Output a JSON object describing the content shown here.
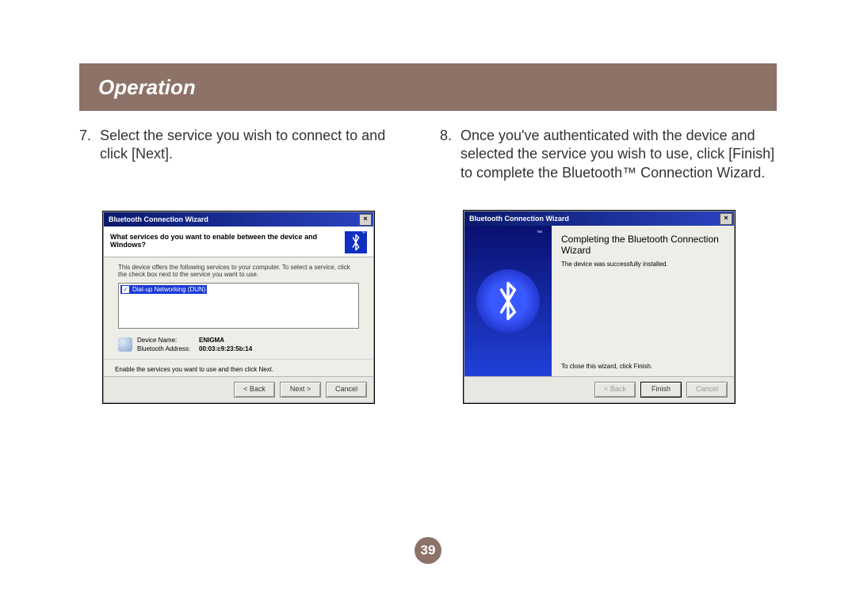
{
  "header": "Operation",
  "page_number": "39",
  "steps": [
    {
      "num": "7.",
      "text": "Select the service you wish to connect to and click [Next]."
    },
    {
      "num": "8.",
      "text": "Once you've authenticated with the device and selected the service you wish to use, click [Finish] to complete the Bluetooth™ Connection Wizard."
    }
  ],
  "dialogA": {
    "title": "Bluetooth Connection Wizard",
    "prompt": "What services do you want to enable between the device and Windows?",
    "subtext": "This device offers the following services to your computer. To select a service, click the check box next to the service you want to use.",
    "service": "Dial-up Networking (DUN)",
    "device_name_label": "Device Name:",
    "device_name_value": "ENIGMA",
    "bt_addr_label": "Bluetooth Address:",
    "bt_addr_value": "00:03:c9:23:5b:14",
    "hint": "Enable the services you want to use and then click Next.",
    "btn_back": "< Back",
    "btn_next": "Next >",
    "btn_cancel": "Cancel"
  },
  "dialogB": {
    "title": "Bluetooth Connection Wizard",
    "heading": "Completing the Bluetooth Connection Wizard",
    "msg": "The device was successfully installed.",
    "close_hint": "To close this wizard, click Finish.",
    "btn_back": "< Back",
    "btn_finish": "Finish",
    "btn_cancel": "Cancel"
  }
}
